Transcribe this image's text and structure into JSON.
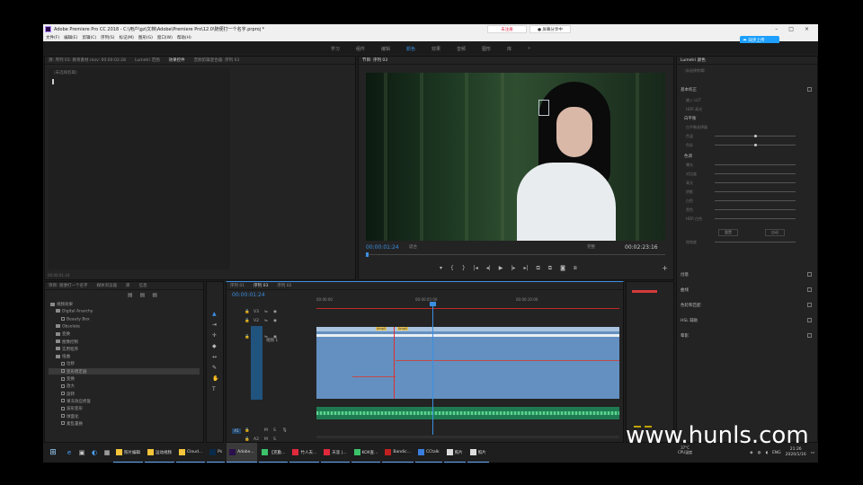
{
  "window": {
    "title": "Adobe Premiere Pro CC 2018 - C:\\用户\\gz\\文档\\Adobe\\Premiere Pro\\12.0\\随便打一个名字.prproj *",
    "register_label": "未注册",
    "share_label": "● 屏幕分享中",
    "minimize": "–",
    "maximize": "□",
    "close": "×"
  },
  "menu": [
    "文件(F)",
    "编辑(E)",
    "剪辑(C)",
    "序列(S)",
    "标记(M)",
    "图形(G)",
    "窗口(W)",
    "帮助(H)"
  ],
  "cloud_badge": "同步上传",
  "workspaces": {
    "items": [
      "学习",
      "组件",
      "编辑",
      "颜色",
      "效果",
      "音频",
      "图形",
      "库"
    ],
    "active": "颜色",
    "more": "»"
  },
  "effect_controls": {
    "tabs": [
      "源: 序列 03: 教育素材.mov: 00:00:02:28",
      "Lumetri 范围",
      "效果控件",
      "音频剪辑混合器: 序列 03"
    ],
    "active_tab": "效果控件",
    "clip_label": "（未选择剪辑）",
    "timecode": "00:00:01:24"
  },
  "program_monitor": {
    "tab": "节目: 序列 03",
    "timecode_current": "00:00:01:24",
    "fit": "适合",
    "quality": "完整",
    "timecode_duration": "00:02:23:16",
    "controls": [
      "▾",
      "{",
      "}",
      "|◂",
      "◂|",
      "▶",
      "|▸",
      "▸|",
      "⧉",
      "⧉",
      "◙",
      "⧈"
    ],
    "add_button": "+"
  },
  "lumetri": {
    "tab": "Lumetri 颜色",
    "clip": "（未选择剪辑）",
    "sections": [
      "基本校正",
      "创意",
      "曲线",
      "色轮和匹配",
      "HSL 辅助",
      "晕影"
    ],
    "basic": {
      "input_lut": "输入 LUT",
      "hdr": "HDR 高光",
      "white_balance": "白平衡",
      "wb_selector": "白平衡选择器",
      "temperature": "色温",
      "tint": "色彩",
      "tone": "色调",
      "tone_items": [
        "曝光",
        "对比度",
        "高光",
        "阴影",
        "白色",
        "黑色",
        "HDR 白色"
      ],
      "saturation": "饱和度",
      "reset": "重置",
      "auto": "自动"
    }
  },
  "project": {
    "tabs": [
      "项目: 随便打一个名字",
      "媒体浏览器",
      "库",
      "信息"
    ],
    "tree": [
      {
        "label": "视频效果",
        "kind": "folder",
        "indent": 0
      },
      {
        "label": "Digital Anarchy",
        "kind": "folder",
        "indent": 1
      },
      {
        "label": "Beauty Box",
        "kind": "item",
        "indent": 2
      },
      {
        "label": "Obsolete",
        "kind": "folder",
        "indent": 1
      },
      {
        "label": "变换",
        "kind": "folder",
        "indent": 1
      },
      {
        "label": "图像控制",
        "kind": "folder",
        "indent": 1
      },
      {
        "label": "实用程序",
        "kind": "folder",
        "indent": 1
      },
      {
        "label": "扭曲",
        "kind": "folder",
        "indent": 1
      },
      {
        "label": "位移",
        "kind": "item",
        "indent": 2
      },
      {
        "label": "变形稳定器",
        "kind": "item",
        "indent": 2
      },
      {
        "label": "变换",
        "kind": "item",
        "indent": 2
      },
      {
        "label": "放大",
        "kind": "item",
        "indent": 2
      },
      {
        "label": "旋转",
        "kind": "item",
        "indent": 2
      },
      {
        "label": "果冻效应修复",
        "kind": "item",
        "indent": 2
      },
      {
        "label": "波形变形",
        "kind": "item",
        "indent": 2
      },
      {
        "label": "球面化",
        "kind": "item",
        "indent": 2
      },
      {
        "label": "紊乱置换",
        "kind": "item",
        "indent": 2
      }
    ],
    "selected_index": 9
  },
  "timeline": {
    "tabs": [
      "序列 01",
      "序列 03",
      "序列 02"
    ],
    "active_tab": "序列 03",
    "timecode": "00:00:01:24",
    "ruler": [
      "00:00:00",
      "00:00:05:00",
      "00:00:10:00"
    ],
    "tracks": {
      "v_labels": [
        "V3",
        "V2",
        "V1"
      ],
      "v1_name": "视频 1",
      "a_labels": [
        "A1",
        "A2"
      ],
      "source": "V1"
    },
    "fx_badges": [
      "Ampli",
      "Ampli"
    ]
  },
  "taskbar": {
    "apps": [
      {
        "label": "照片编辑",
        "color": "#f5c43a"
      },
      {
        "label": "运动视频",
        "color": "#f5c43a"
      },
      {
        "label": "Cloud...",
        "color": "#f5c43a"
      },
      {
        "label": "Ps",
        "color": "#0a2a4a"
      },
      {
        "label": "Adobe...",
        "color": "#2a0f4a"
      },
      {
        "label": "【克勤...",
        "color": "#3cc26a"
      },
      {
        "label": "竹人夫...",
        "color": "#e0283c"
      },
      {
        "label": "天涯 |...",
        "color": "#e0283c"
      },
      {
        "label": "KOX查...",
        "color": "#3cc26a"
      },
      {
        "label": "Bandic...",
        "color": "#c02020"
      },
      {
        "label": "CCtalk",
        "color": "#3a7ee0"
      },
      {
        "label": "照片",
        "color": "#ddd"
      },
      {
        "label": "照片",
        "color": "#ddd"
      }
    ],
    "temperature": "37°C",
    "temperature_label": "CPU温度",
    "lang": "ENG",
    "time": "21:26",
    "date": "2020/1/16"
  },
  "watermark": "www.hunls.com"
}
